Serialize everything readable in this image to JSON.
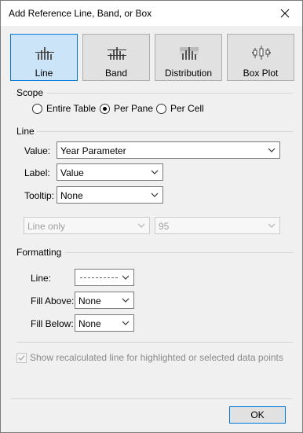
{
  "window": {
    "title": "Add Reference Line, Band, or Box"
  },
  "types": [
    {
      "label": "Line",
      "icon": "reference-line-icon",
      "selected": true
    },
    {
      "label": "Band",
      "icon": "reference-band-icon",
      "selected": false
    },
    {
      "label": "Distribution",
      "icon": "distribution-icon",
      "selected": false
    },
    {
      "label": "Box Plot",
      "icon": "box-plot-icon",
      "selected": false
    }
  ],
  "scope": {
    "heading": "Scope",
    "options": [
      "Entire Table",
      "Per Pane",
      "Per Cell"
    ],
    "selected": "Per Pane"
  },
  "line": {
    "heading": "Line",
    "value_label": "Value:",
    "value": "Year Parameter",
    "label_label": "Label:",
    "label_value": "Value",
    "tooltip_label": "Tooltip:",
    "tooltip_value": "None",
    "line_mode": "Line only",
    "confidence": "95"
  },
  "formatting": {
    "heading": "Formatting",
    "line_label": "Line:",
    "fill_above_label": "Fill Above:",
    "fill_above_value": "None",
    "fill_below_label": "Fill Below:",
    "fill_below_value": "None"
  },
  "recalc": {
    "label": "Show recalculated line for highlighted or selected data points",
    "checked": true,
    "enabled": false
  },
  "footer": {
    "ok_label": "OK"
  },
  "colors": {
    "accent": "#0078d7",
    "selected_bg": "#cce4f7",
    "dialog_bg": "#f0f0f0"
  }
}
